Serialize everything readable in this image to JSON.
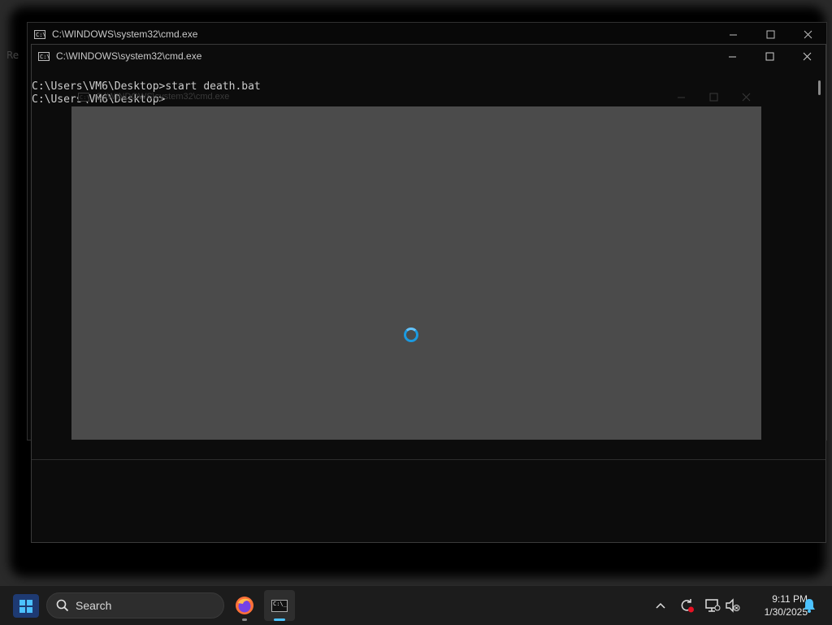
{
  "desktop": {
    "fragment_text": "Re"
  },
  "back_window": {
    "title": "C:\\WINDOWS\\system32\\cmd.exe",
    "icon_text": "C:\\"
  },
  "front_window": {
    "title": "C:\\WINDOWS\\system32\\cmd.exe",
    "icon_text": "C:\\",
    "console_lines": [
      "C:\\Users\\VM6\\Desktop>start death.bat",
      "",
      "C:\\Users\\VM6\\Desktop>"
    ]
  },
  "ghost_window": {
    "title": "C:\\WINDOWS\\system32\\cmd.exe",
    "icon_text": "C:\\"
  },
  "taskbar": {
    "search_label": "Search",
    "time": "9:11 PM",
    "date": "1/30/2025",
    "cmd_icon_text": "C:\\_"
  },
  "colors": {
    "accent": "#4cc2ff",
    "spinner": "#1b9ae0",
    "loading_bg": "#4b4b4b",
    "console_text": "#cccccc"
  }
}
